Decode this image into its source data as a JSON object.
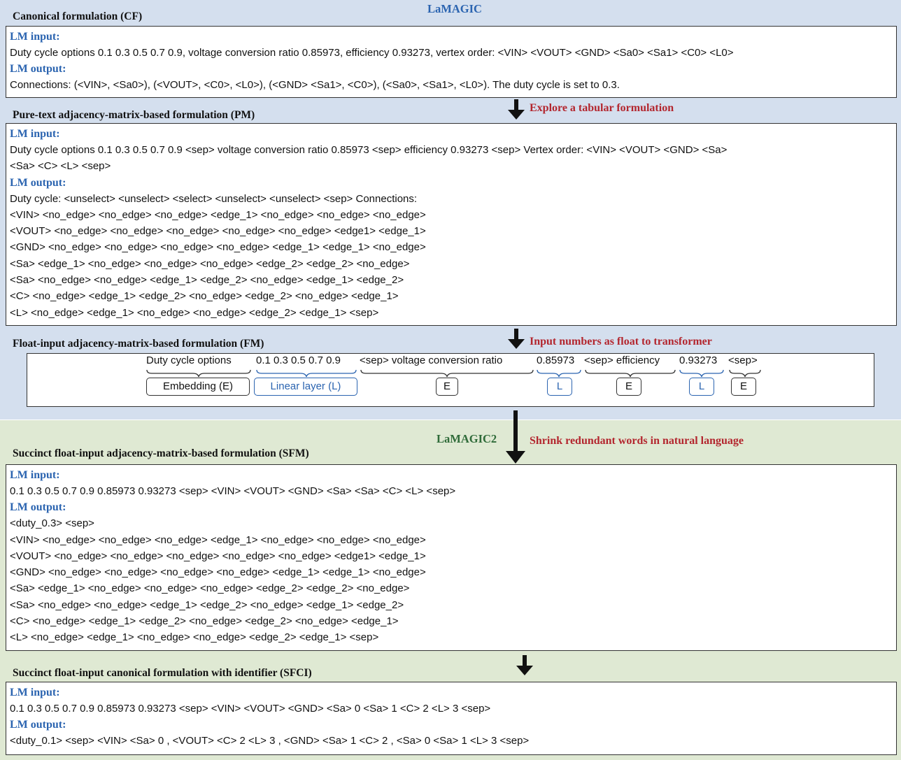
{
  "header": {
    "lamagic_label": "LaMAGIC",
    "lamagic2_label": "LaMAGIC2"
  },
  "common": {
    "lm_input_label": "LM input:",
    "lm_output_label": "LM output:"
  },
  "cf": {
    "title": "Canonical formulation (CF)",
    "input": "Duty cycle options 0.1 0.3 0.5 0.7 0.9, voltage conversion ratio 0.85973, efficiency 0.93273, vertex order: <VIN> <VOUT> <GND> <Sa0> <Sa1> <C0> <L0>",
    "output": "Connections: (<VIN>, <Sa0>), (<VOUT>, <C0>, <L0>), (<GND> <Sa1>, <C0>), (<Sa0>, <Sa1>, <L0>). The duty cycle is set to 0.3."
  },
  "pm": {
    "title": "Pure-text adjacency-matrix-based formulation (PM)",
    "arrow_note": "Explore a tabular formulation",
    "input_lines": [
      "Duty cycle options 0.1 0.3 0.5 0.7 0.9 <sep> voltage conversion ratio 0.85973 <sep> efficiency 0.93273 <sep> Vertex order:  <VIN> <VOUT> <GND> <Sa>",
      "<Sa> <C> <L> <sep>"
    ],
    "output_lines": [
      "Duty cycle: <unselect> <unselect> <select> <unselect> <unselect> <sep> Connections:",
      "<VIN> <no_edge> <no_edge> <no_edge> <edge_1> <no_edge> <no_edge> <no_edge>",
      "<VOUT> <no_edge> <no_edge> <no_edge> <no_edge> <no_edge> <edge1> <edge_1>",
      "<GND> <no_edge> <no_edge> <no_edge> <no_edge> <edge_1> <edge_1> <no_edge>",
      "<Sa> <edge_1> <no_edge> <no_edge> <no_edge> <edge_2> <edge_2> <no_edge>",
      "<Sa> <no_edge> <no_edge> <edge_1> <edge_2> <no_edge> <edge_1> <edge_2>",
      "<C> <no_edge> <edge_1> <edge_2> <no_edge> <edge_2> <no_edge> <edge_1>",
      "<L> <no_edge> <edge_1> <no_edge> <no_edge> <edge_2> <edge_1> <sep>"
    ]
  },
  "fm": {
    "title": "Float-input adjacency-matrix-based formulation (FM)",
    "arrow_note": "Input numbers as float to transformer",
    "segments": [
      "Duty cycle options",
      "0.1 0.3 0.5 0.7 0.9",
      "<sep> voltage conversion ratio",
      "0.85973",
      "<sep> efficiency",
      "0.93273",
      "<sep>"
    ],
    "tags": [
      "Embedding (E)",
      "Linear layer (L)",
      "E",
      "L",
      "E",
      "L",
      "E"
    ]
  },
  "sfm": {
    "title": "Succinct float-input adjacency-matrix-based formulation (SFM)",
    "arrow_note": "Shrink redundant words in natural language",
    "input_lines": [
      "0.1 0.3 0.5 0.7 0.9 0.85973 0.93273 <sep> <VIN> <VOUT> <GND> <Sa> <Sa> <C> <L> <sep>"
    ],
    "output_lines": [
      "<duty_0.3> <sep>",
      "<VIN> <no_edge> <no_edge> <no_edge> <edge_1> <no_edge> <no_edge> <no_edge>",
      "<VOUT> <no_edge> <no_edge> <no_edge> <no_edge> <no_edge> <edge1> <edge_1>",
      "<GND> <no_edge> <no_edge> <no_edge> <no_edge> <edge_1> <edge_1> <no_edge>",
      "<Sa> <edge_1> <no_edge> <no_edge> <no_edge> <edge_2> <edge_2> <no_edge>",
      "<Sa> <no_edge> <no_edge> <edge_1> <edge_2> <no_edge> <edge_1> <edge_2>",
      "<C> <no_edge> <edge_1> <edge_2> <no_edge> <edge_2> <no_edge> <edge_1>",
      "<L> <no_edge> <edge_1> <no_edge> <no_edge> <edge_2> <edge_1> <sep>"
    ]
  },
  "sfci": {
    "title": "Succinct float-input canonical formulation with identifier (SFCI)",
    "input_lines": [
      "0.1 0.3 0.5 0.7 0.9 0.85973 0.93273 <sep> <VIN> <VOUT> <GND> <Sa> 0 <Sa> 1 <C> 2 <L> 3 <sep>"
    ],
    "output_lines": [
      "<duty_0.1> <sep>  <VIN> <Sa> 0 ,  <VOUT> <C> 2 <L> 3 , <GND> <Sa> 1 <C> 2 , <Sa> 0 <Sa> 1 <L> 3 <sep>"
    ]
  },
  "colors": {
    "blue_region": "#d4dfee",
    "green_region": "#dfe9d3",
    "section_label": "#2b64b0",
    "note_red": "#b3262e",
    "lamagic2_green": "#2f6b39"
  },
  "icons": [
    "down-arrow-icon",
    "curly-brace-icon"
  ]
}
